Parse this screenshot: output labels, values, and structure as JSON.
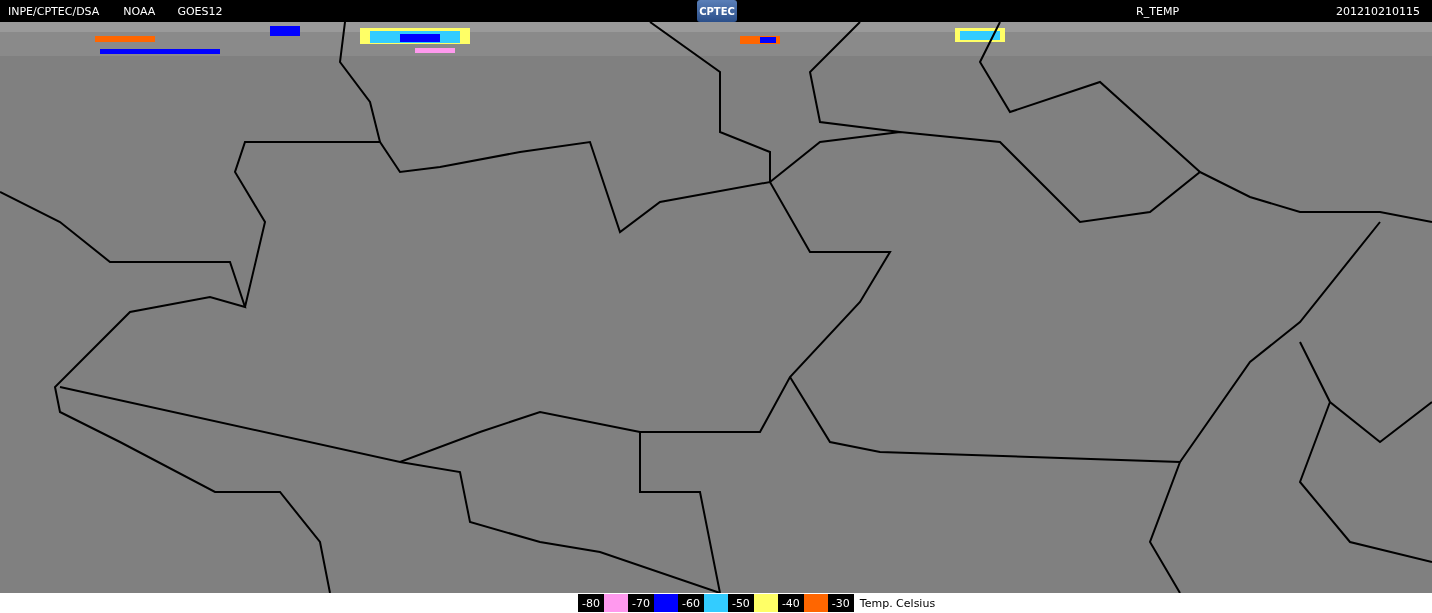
{
  "header": {
    "source": "INPE/CPTEC/DSA",
    "agency": "NOAA",
    "satellite": "GOES12",
    "logo": "CPTEC",
    "product": "R_TEMP",
    "timestamp": "201210210115"
  },
  "legend": {
    "steps": [
      {
        "label": "-80",
        "color": "#ff99ee"
      },
      {
        "label": "-70",
        "color": "#0000ff"
      },
      {
        "label": "-60",
        "color": "#33ccff"
      },
      {
        "label": "-50",
        "color": "#ffff66"
      },
      {
        "label": "-40",
        "color": "#ff6600"
      },
      {
        "label": "-30"
      }
    ],
    "unit": "Temp. Celsius"
  }
}
